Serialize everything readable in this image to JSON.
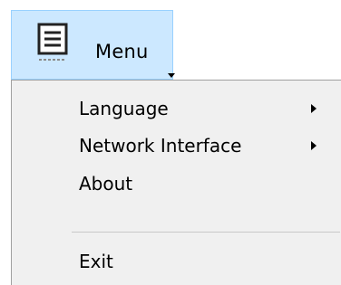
{
  "menu_button": {
    "label": "Menu",
    "icon": "document-lines-icon",
    "state": "pressed",
    "colors": {
      "background": "#cce8ff",
      "border": "#99d1ff"
    }
  },
  "dropdown": {
    "background": "#f0f0f0",
    "items": [
      {
        "label": "Language",
        "has_submenu": true
      },
      {
        "label": "Network Interface",
        "has_submenu": true
      },
      {
        "label": "About",
        "has_submenu": false
      },
      {
        "type": "separator"
      },
      {
        "label": "Exit",
        "has_submenu": false
      }
    ]
  }
}
